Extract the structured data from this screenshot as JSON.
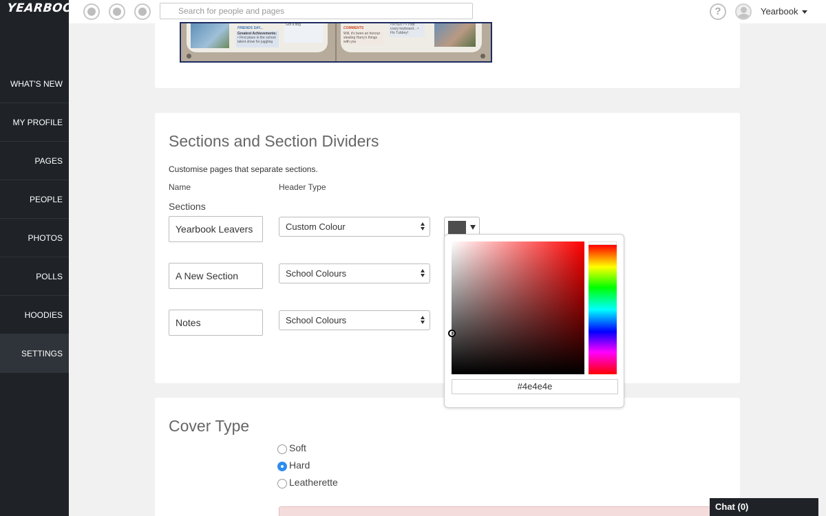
{
  "app": {
    "logo": "YEARBOOK"
  },
  "sidebar": {
    "items": [
      {
        "label": "WHAT'S NEW"
      },
      {
        "label": "MY PROFILE"
      },
      {
        "label": "PAGES"
      },
      {
        "label": "PEOPLE"
      },
      {
        "label": "PHOTOS"
      },
      {
        "label": "POLLS"
      },
      {
        "label": "HOODIES"
      },
      {
        "label": "SETTINGS",
        "active": true
      }
    ]
  },
  "topbar": {
    "search_placeholder": "Search for people and pages",
    "help_glyph": "?",
    "user_name": "Yearbook"
  },
  "preview": {
    "left_tag": "FRIENDS SAY...",
    "left_note_title": "Greatest Achievements:",
    "left_note_body": "• First place in the school talent show for juggling",
    "left_note_small": "Got a dog",
    "right_tag": "COMMENTS",
    "right_note_body": "Will, it's been an honour stealing Harry's things with you",
    "right_note_small": "• RTGIT? • That crazy keyboard... • Flo Tubbey!"
  },
  "sections_card": {
    "title": "Sections and Section Dividers",
    "description": "Customise pages that separate sections.",
    "col_name": "Name",
    "col_header_type": "Header Type",
    "sub_label": "Sections",
    "rows": [
      {
        "name": "Yearbook Leavers",
        "header_type": "Custom Colour"
      },
      {
        "name": "A New Section",
        "header_type": "School Colours"
      },
      {
        "name": "Notes",
        "header_type": "School Colours"
      }
    ],
    "color_value": "#4e4e4e"
  },
  "cover_card": {
    "title": "Cover Type",
    "options": [
      {
        "label": "Soft",
        "checked": false
      },
      {
        "label": "Hard",
        "checked": true
      },
      {
        "label": "Leatherette",
        "checked": false
      }
    ]
  },
  "chat": {
    "label": "Chat (0)"
  }
}
